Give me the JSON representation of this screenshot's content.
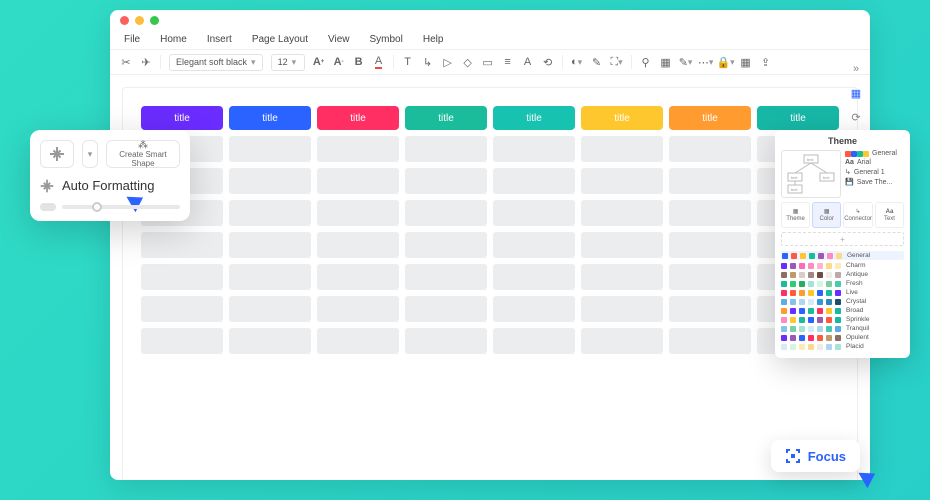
{
  "menubar": [
    "File",
    "Home",
    "Insert",
    "Page Layout",
    "View",
    "Symbol",
    "Help"
  ],
  "toolbar": {
    "font_name": "Elegant soft black",
    "font_size": "12",
    "icons": [
      "cut-icon",
      "format-painter-icon",
      "bold-icon",
      "font-size-up-icon",
      "font-size-down-icon",
      "font-color-icon",
      "text-tool-icon",
      "line-tool-icon",
      "pointer-icon",
      "layer-icon",
      "group-icon",
      "align-icon",
      "align-text-icon",
      "rotate-icon",
      "distribute-icon",
      "fill-icon",
      "eyedropper-icon",
      "crop-icon",
      "zoom-icon",
      "table-icon",
      "highlighter-icon",
      "settings-icon",
      "lock-icon",
      "grid-icon",
      "share-icon"
    ]
  },
  "table": {
    "headers": [
      {
        "label": "title",
        "color": "#6a2cff"
      },
      {
        "label": "title",
        "color": "#2a63ff"
      },
      {
        "label": "title",
        "color": "#ff2e63"
      },
      {
        "label": "title",
        "color": "#1abc9c"
      },
      {
        "label": "title",
        "color": "#18c2b0"
      },
      {
        "label": "title",
        "color": "#ffc72e"
      },
      {
        "label": "title",
        "color": "#ff9b2f"
      },
      {
        "label": "title",
        "color": "#17b7a6"
      }
    ],
    "body_rows": 7
  },
  "left_popup": {
    "smart_shape_label": "Create Smart Shape",
    "auto_formatting_label": "Auto Formatting"
  },
  "right_rail": [
    "collapse-icon",
    "grid-icon",
    "rotate-icon",
    "layers-icon",
    "page-icon",
    "a-icon",
    "maximize-icon",
    "cart-icon",
    "help-icon"
  ],
  "theme_panel": {
    "title": "Theme",
    "list": [
      "General",
      "Arial",
      "General 1",
      "Save The..."
    ],
    "tabs": [
      "Theme",
      "Color",
      "Connector",
      "Text"
    ],
    "selected_tab": 1,
    "palettes": [
      {
        "name": "General",
        "sel": true,
        "c": [
          "#2a63ff",
          "#ff5a3c",
          "#ffc72e",
          "#1abc9c",
          "#9b59b6",
          "#ff8ac2",
          "#ffd98a"
        ]
      },
      {
        "name": "Charm",
        "c": [
          "#6a2cff",
          "#9b59b6",
          "#ff6bb5",
          "#ff8ac2",
          "#ffb3d1",
          "#ffd98a",
          "#ffe9b8"
        ]
      },
      {
        "name": "Antique",
        "c": [
          "#8d6e63",
          "#c19a6b",
          "#d7ccc8",
          "#a1887f",
          "#6d4c41",
          "#efebe9",
          "#bcaaa4"
        ]
      },
      {
        "name": "Fresh",
        "c": [
          "#1abc9c",
          "#2ecc71",
          "#27ae60",
          "#a3e4d7",
          "#d5f5e3",
          "#7dcea0",
          "#48c9b0"
        ]
      },
      {
        "name": "Live",
        "c": [
          "#ff2e63",
          "#ff5a3c",
          "#ff9b2f",
          "#ffc72e",
          "#2a63ff",
          "#1abc9c",
          "#6a2cff"
        ]
      },
      {
        "name": "Crystal",
        "c": [
          "#5dade2",
          "#85c1e9",
          "#aed6f1",
          "#d6eaf8",
          "#3498db",
          "#2e86c1",
          "#1b4f72"
        ]
      },
      {
        "name": "Broad",
        "c": [
          "#ff9b2f",
          "#6a2cff",
          "#2a63ff",
          "#1abc9c",
          "#ff2e63",
          "#ffc72e",
          "#17b7a6"
        ]
      },
      {
        "name": "Sprinkle",
        "c": [
          "#ff8ac2",
          "#ffc72e",
          "#1abc9c",
          "#2a63ff",
          "#9b59b6",
          "#ff5a3c",
          "#17b7a6"
        ]
      },
      {
        "name": "Tranquil",
        "c": [
          "#85c1e9",
          "#7dcea0",
          "#a3e4d7",
          "#d6eaf8",
          "#aed6f1",
          "#48c9b0",
          "#5dade2"
        ]
      },
      {
        "name": "Opulent",
        "c": [
          "#6a2cff",
          "#9b59b6",
          "#2a63ff",
          "#ff2e63",
          "#ff5a3c",
          "#c19a6b",
          "#8d6e63"
        ]
      },
      {
        "name": "Placid",
        "c": [
          "#d6eaf8",
          "#d5f5e3",
          "#ffe9b8",
          "#ffd98a",
          "#efebe9",
          "#aed6f1",
          "#a3e4d7"
        ]
      }
    ]
  },
  "focus_button": {
    "label": "Focus"
  }
}
